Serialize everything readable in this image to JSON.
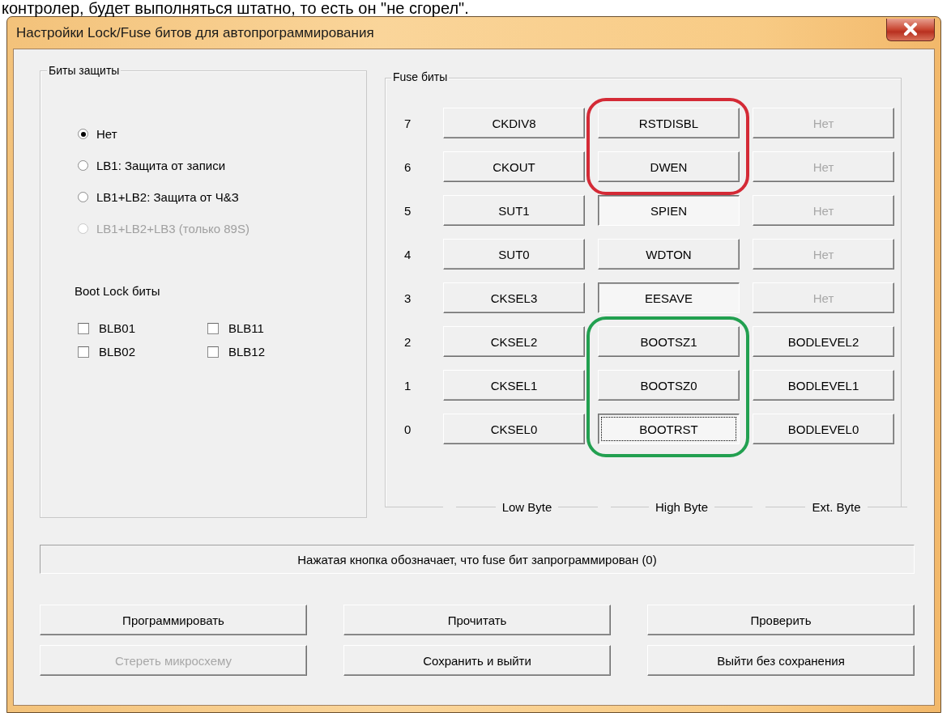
{
  "caption": "контролер, будет выполняться штатно, то есть он \"не сгорел\".",
  "window": {
    "title": "Настройки Lock/Fuse битов для автопрограммирования"
  },
  "protection": {
    "title": "Биты защиты",
    "options": [
      {
        "label": "Нет",
        "selected": true,
        "disabled": false
      },
      {
        "label": "LB1: Защита от записи",
        "selected": false,
        "disabled": false
      },
      {
        "label": "LB1+LB2: Защита от Ч&З",
        "selected": false,
        "disabled": false
      },
      {
        "label": "LB1+LB2+LB3 (только 89S)",
        "selected": false,
        "disabled": true
      }
    ],
    "boot_lock_title": "Boot Lock биты",
    "boot_lock": [
      {
        "label": "BLB01",
        "checked": false
      },
      {
        "label": "BLB11",
        "checked": false
      },
      {
        "label": "BLB02",
        "checked": false
      },
      {
        "label": "BLB12",
        "checked": false
      }
    ]
  },
  "fuses": {
    "title": "Fuse биты",
    "rows": [
      {
        "bit": "7",
        "cells": [
          {
            "label": "CKDIV8",
            "pressed": false,
            "disabled": false,
            "focused": false
          },
          {
            "label": "RSTDISBL",
            "pressed": false,
            "disabled": false,
            "focused": false
          },
          {
            "label": "Нет",
            "pressed": false,
            "disabled": true,
            "focused": false
          }
        ]
      },
      {
        "bit": "6",
        "cells": [
          {
            "label": "CKOUT",
            "pressed": false,
            "disabled": false,
            "focused": false
          },
          {
            "label": "DWEN",
            "pressed": false,
            "disabled": false,
            "focused": false
          },
          {
            "label": "Нет",
            "pressed": false,
            "disabled": true,
            "focused": false
          }
        ]
      },
      {
        "bit": "5",
        "cells": [
          {
            "label": "SUT1",
            "pressed": false,
            "disabled": false,
            "focused": false
          },
          {
            "label": "SPIEN",
            "pressed": true,
            "disabled": false,
            "focused": false
          },
          {
            "label": "Нет",
            "pressed": false,
            "disabled": true,
            "focused": false
          }
        ]
      },
      {
        "bit": "4",
        "cells": [
          {
            "label": "SUT0",
            "pressed": false,
            "disabled": false,
            "focused": false
          },
          {
            "label": "WDTON",
            "pressed": false,
            "disabled": false,
            "focused": false
          },
          {
            "label": "Нет",
            "pressed": false,
            "disabled": true,
            "focused": false
          }
        ]
      },
      {
        "bit": "3",
        "cells": [
          {
            "label": "CKSEL3",
            "pressed": false,
            "disabled": false,
            "focused": false
          },
          {
            "label": "EESAVE",
            "pressed": true,
            "disabled": false,
            "focused": false
          },
          {
            "label": "Нет",
            "pressed": false,
            "disabled": true,
            "focused": false
          }
        ]
      },
      {
        "bit": "2",
        "cells": [
          {
            "label": "CKSEL2",
            "pressed": false,
            "disabled": false,
            "focused": false
          },
          {
            "label": "BOOTSZ1",
            "pressed": false,
            "disabled": false,
            "focused": false
          },
          {
            "label": "BODLEVEL2",
            "pressed": false,
            "disabled": false,
            "focused": false
          }
        ]
      },
      {
        "bit": "1",
        "cells": [
          {
            "label": "CKSEL1",
            "pressed": false,
            "disabled": false,
            "focused": false
          },
          {
            "label": "BOOTSZ0",
            "pressed": false,
            "disabled": false,
            "focused": false
          },
          {
            "label": "BODLEVEL1",
            "pressed": false,
            "disabled": false,
            "focused": false
          }
        ]
      },
      {
        "bit": "0",
        "cells": [
          {
            "label": "CKSEL0",
            "pressed": false,
            "disabled": false,
            "focused": false
          },
          {
            "label": "BOOTRST",
            "pressed": true,
            "disabled": false,
            "focused": true
          },
          {
            "label": "BODLEVEL0",
            "pressed": false,
            "disabled": false,
            "focused": false
          }
        ]
      }
    ],
    "byte_labels": [
      "Low Byte",
      "High Byte",
      "Ext. Byte"
    ]
  },
  "annotations": [
    {
      "color": "#d42a36"
    },
    {
      "color": "#22a050"
    }
  ],
  "status": "Нажатая кнопка обозначает, что fuse бит запрограммирован (0)",
  "buttons": [
    {
      "label": "Программировать",
      "disabled": false
    },
    {
      "label": "Прочитать",
      "disabled": false
    },
    {
      "label": "Проверить",
      "disabled": false
    },
    {
      "label": "Стереть микросхему",
      "disabled": true
    },
    {
      "label": "Сохранить и выйти",
      "disabled": false
    },
    {
      "label": "Выйти без сохранения",
      "disabled": false
    }
  ]
}
